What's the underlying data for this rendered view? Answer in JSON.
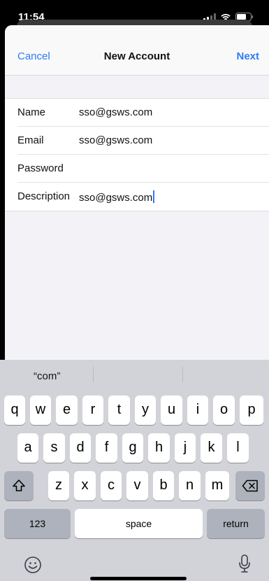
{
  "status": {
    "time": "11:54"
  },
  "nav": {
    "cancel": "Cancel",
    "title": "New Account",
    "next": "Next"
  },
  "form": {
    "rows": [
      {
        "label": "Name",
        "value": "sso@gsws.com"
      },
      {
        "label": "Email",
        "value": "sso@gsws.com"
      },
      {
        "label": "Password",
        "value": ""
      },
      {
        "label": "Description",
        "value": "sso@gsws.com"
      }
    ]
  },
  "keyboard": {
    "suggestions": [
      "“com”",
      "",
      ""
    ],
    "row1": [
      "q",
      "w",
      "e",
      "r",
      "t",
      "y",
      "u",
      "i",
      "o",
      "p"
    ],
    "row2": [
      "a",
      "s",
      "d",
      "f",
      "g",
      "h",
      "j",
      "k",
      "l"
    ],
    "row3": [
      "z",
      "x",
      "c",
      "v",
      "b",
      "n",
      "m"
    ],
    "numbers_key": "123",
    "space_key": "space",
    "return_key": "return"
  },
  "icons": {
    "signal": "cellular-signal-icon",
    "wifi": "wifi-icon",
    "battery": "battery-icon",
    "shift": "shift-icon",
    "delete": "delete-backspace-icon",
    "emoji": "emoji-icon",
    "mic": "microphone-icon"
  },
  "colors": {
    "accent": "#2f7bf6"
  }
}
